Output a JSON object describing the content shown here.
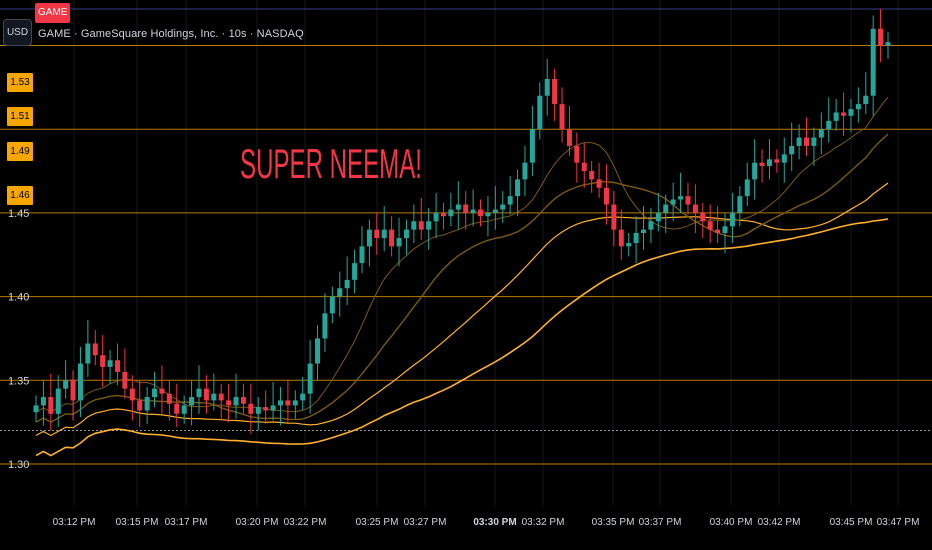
{
  "header": {
    "currency": "USD",
    "ticker_badge": "GAME",
    "symbol_title": "GAME · GameSquare Holdings, Inc. · 10s · NASDAQ"
  },
  "price_tags": [
    "1.53",
    "1.51",
    "1.49",
    "1.46"
  ],
  "chart_data": {
    "type": "candlestick",
    "annotation": "SUPER NEEMA!",
    "y_axis": {
      "ticks": [
        "1.30",
        "1.35",
        "1.40",
        "1.45"
      ],
      "ylim": [
        1.285,
        1.57
      ],
      "side": "left"
    },
    "x_axis": {
      "ticks": [
        "03:12 PM",
        "03:15 PM",
        "03:17 PM",
        "03:20 PM",
        "03:22 PM",
        "03:25 PM",
        "03:27 PM",
        "03:30 PM",
        "03:32 PM",
        "03:35 PM",
        "03:37 PM",
        "03:40 PM",
        "03:42 PM",
        "03:45 PM",
        "03:47 PM"
      ],
      "bold_tick": "03:30 PM"
    },
    "horizontal_levels": [
      1.3,
      1.35,
      1.4,
      1.45,
      1.5,
      1.55
    ],
    "dotted_level": 1.32,
    "colors": {
      "up": "#26a69a",
      "down": "#f23645",
      "level": "#f7a600",
      "ma_bright": "#ffb02e",
      "ma_dim": "#7a5a12"
    },
    "candles_close": [
      1.335,
      1.34,
      1.33,
      1.345,
      1.35,
      1.338,
      1.36,
      1.372,
      1.365,
      1.358,
      1.362,
      1.355,
      1.345,
      1.338,
      1.332,
      1.34,
      1.345,
      1.342,
      1.336,
      1.33,
      1.335,
      1.34,
      1.345,
      1.338,
      1.342,
      1.338,
      1.335,
      1.34,
      1.336,
      1.33,
      1.334,
      1.332,
      1.335,
      1.338,
      1.335,
      1.338,
      1.342,
      1.36,
      1.375,
      1.39,
      1.4,
      1.405,
      1.41,
      1.42,
      1.43,
      1.44,
      1.435,
      1.44,
      1.43,
      1.435,
      1.44,
      1.445,
      1.44,
      1.445,
      1.45,
      1.448,
      1.452,
      1.455,
      1.45,
      1.452,
      1.448,
      1.45,
      1.452,
      1.455,
      1.46,
      1.47,
      1.48,
      1.5,
      1.52,
      1.53,
      1.515,
      1.5,
      1.49,
      1.48,
      1.475,
      1.47,
      1.465,
      1.455,
      1.44,
      1.43,
      1.432,
      1.438,
      1.44,
      1.445,
      1.45,
      1.455,
      1.458,
      1.46,
      1.455,
      1.45,
      1.445,
      1.44,
      1.438,
      1.442,
      1.45,
      1.46,
      1.47,
      1.48,
      1.478,
      1.482,
      1.48,
      1.485,
      1.49,
      1.495,
      1.49,
      1.495,
      1.5,
      1.505,
      1.51,
      1.508,
      1.512,
      1.515,
      1.52,
      1.56,
      1.55,
      1.552
    ]
  }
}
